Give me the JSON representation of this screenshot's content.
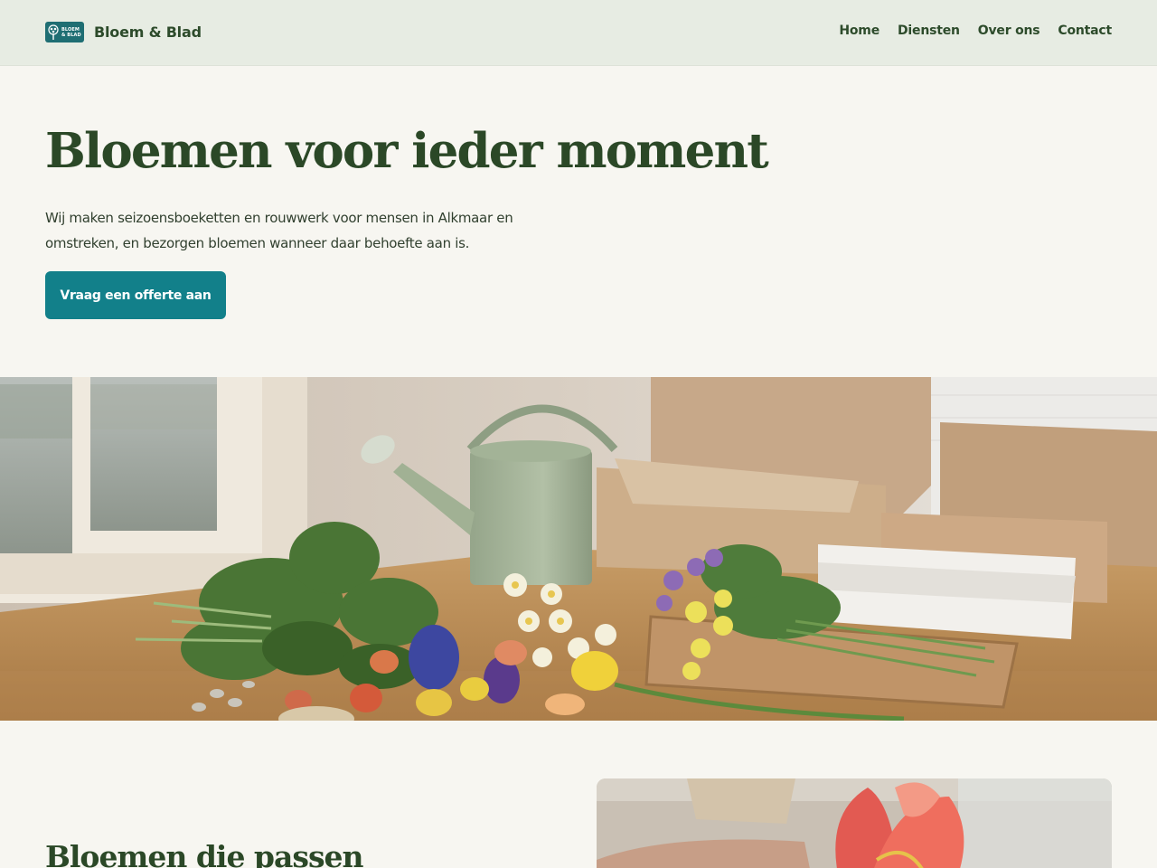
{
  "brand": {
    "name": "Bloem & Blad",
    "logo_text_line1": "BLOEM",
    "logo_text_line2": "& BLAD"
  },
  "nav": {
    "items": [
      "Home",
      "Diensten",
      "Over ons",
      "Contact"
    ]
  },
  "hero": {
    "title": "Bloemen voor ieder moment",
    "text": "Wij maken seizoensboeketten en rouwwerk voor mensen in Alkmaar en omstreken, en bezorgen bloemen wanneer daar behoefte aan is.",
    "cta_label": "Vraag een offerte aan"
  },
  "section": {
    "title": "Bloemen die passen"
  },
  "colors": {
    "header_bg": "#e7ece3",
    "page_bg": "#f7f6f1",
    "heading": "#2b4827",
    "accent": "#12808a"
  }
}
